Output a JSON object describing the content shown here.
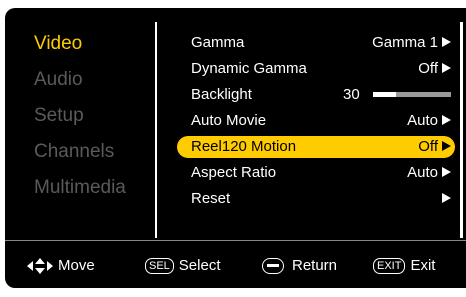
{
  "sidebar": {
    "items": [
      {
        "label": "Video",
        "active": true
      },
      {
        "label": "Audio",
        "active": false
      },
      {
        "label": "Setup",
        "active": false
      },
      {
        "label": "Channels",
        "active": false
      },
      {
        "label": "Multimedia",
        "active": false
      }
    ]
  },
  "video_settings": {
    "gamma": {
      "label": "Gamma",
      "value": "Gamma 1"
    },
    "dynamic_gamma": {
      "label": "Dynamic Gamma",
      "value": "Off"
    },
    "backlight": {
      "label": "Backlight",
      "value": "30",
      "level_percent": 30
    },
    "auto_movie": {
      "label": "Auto Movie",
      "value": "Auto"
    },
    "reel120": {
      "label": "Reel120 Motion",
      "value": "Off",
      "selected": true
    },
    "aspect_ratio": {
      "label": "Aspect Ratio",
      "value": "Auto"
    },
    "reset": {
      "label": "Reset"
    }
  },
  "footer": {
    "move": "Move",
    "select_key": "SEL",
    "select": "Select",
    "return": "Return",
    "exit_key": "EXIT",
    "exit": "Exit"
  },
  "colors": {
    "accent": "#ffcc00",
    "background": "#000000",
    "inactive_text": "#5a5a5a"
  }
}
